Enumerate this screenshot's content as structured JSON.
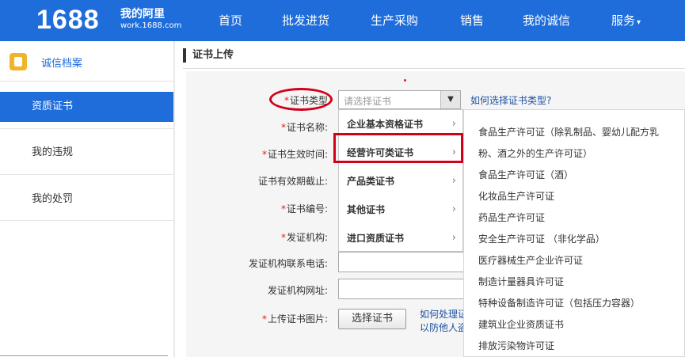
{
  "topbar": {
    "logo": "1688",
    "brand_title": "我的阿里",
    "brand_sub": "work.1688.com",
    "nav": [
      "首页",
      "批发进货",
      "生产采购",
      "销售",
      "我的诚信",
      "服务"
    ],
    "nav_caret": "▾"
  },
  "sidebar": {
    "header": "诚信档案",
    "items": [
      "资质证书",
      "我的违规",
      "我的处罚"
    ]
  },
  "main": {
    "section_title": "证书上传",
    "required_mark": "*",
    "labels": {
      "cert_type": "证书类型",
      "cert_name": "证书名称:",
      "effective": "证书生效时间:",
      "expiry": "证书有效期截止:",
      "cert_no": "证书编号:",
      "issuer": "发证机构:",
      "issuer_phone": "发证机构联系电话:",
      "issuer_url": "发证机构网址:",
      "upload_image": "上传证书图片:"
    },
    "select_placeholder": "请选择证书",
    "help_link": "如何选择证书类型?",
    "choose_button": "选择证书",
    "tip_line1": "如何处理证书",
    "tip_line2": "以防他人盗用"
  },
  "menu": {
    "items": [
      "企业基本资格证书",
      "经营许可类证书",
      "产品类证书",
      "其他证书",
      "进口资质证书"
    ],
    "chevron": "›"
  },
  "submenu": {
    "items": [
      "食品生产许可证（除乳制品、婴幼儿配方乳",
      "粉、酒之外的生产许可证）",
      "食品生产许可证（酒）",
      "化妆品生产许可证",
      "药品生产许可证",
      "安全生产许可证 （非化学品）",
      "医疗器械生产企业许可证",
      "制造计量器具许可证",
      "特种设备制造许可证（包括压力容器）",
      "建筑业企业资质证书",
      "排放污染物许可证"
    ]
  },
  "colors": {
    "brand_blue": "#1e6ddb",
    "highlight_red": "#d4001a"
  }
}
